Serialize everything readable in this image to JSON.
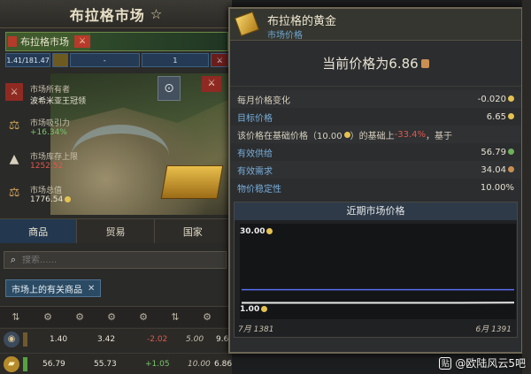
{
  "window": {
    "title": "布拉格市场",
    "star": "☆"
  },
  "market_bar": {
    "label": "布拉格市场",
    "flag": "⚔"
  },
  "stats": {
    "ratio": "1.41/181.47",
    "pop": "-",
    "count": "1",
    "extra": "⚔"
  },
  "owner": {
    "label": "市场所有者",
    "value": "波希米亚王冠领"
  },
  "attraction": {
    "label": "市场吸引力",
    "value": "+16.34%"
  },
  "storage": {
    "label": "市场库存上限",
    "value": "1252.52"
  },
  "total": {
    "label": "市场总值",
    "value": "1776.54"
  },
  "tabs": [
    {
      "label": "商品"
    },
    {
      "label": "贸易"
    },
    {
      "label": "国家"
    }
  ],
  "search": {
    "placeholder": "搜索......"
  },
  "filter": {
    "label": "市场上的有关商品",
    "close": "✕"
  },
  "rows": [
    {
      "icon": "grain",
      "c1": "1.40",
      "c2": "3.42",
      "c3": "-2.02",
      "c4": "5.00",
      "c5": "9.6"
    },
    {
      "icon": "gold",
      "c1": "56.79",
      "c2": "55.73",
      "c3": "+1.05",
      "c4": "10.00",
      "c5": "6.86"
    }
  ],
  "tooltip": {
    "name": "布拉格的黄金",
    "subtitle": "市场价格",
    "current_price": "当前价格为6.86",
    "monthly_change_label": "每月价格变化",
    "monthly_change_value": "-0.020",
    "target_label": "目标价格",
    "target_value": "6.65",
    "base_prefix": "该价格在基础价格（10.00",
    "base_mid": "）的基础上",
    "base_pct": "-33.4%",
    "base_suffix": "，基于",
    "supply_label": "有效供给",
    "supply_value": "56.79",
    "demand_label": "有效需求",
    "demand_value": "34.04",
    "stability_label": "物价稳定性",
    "stability_value": "10.00%",
    "chart_title": "近期市场价格"
  },
  "chart_data": {
    "type": "line",
    "title": "近期市场价格",
    "ylim": [
      1.0,
      30.0
    ],
    "y_top_label": "30.00",
    "y_bottom_label": "1.00",
    "x_start": "7月 1381",
    "x_end": "6月 1391",
    "series": [
      {
        "values": [
          6.86,
          6.86,
          6.86,
          6.86,
          6.86,
          6.86
        ]
      },
      {
        "values": [
          1.2,
          1.2,
          1.2,
          1.2,
          1.2,
          1.3
        ]
      }
    ]
  },
  "watermark": "@欧陆风云5吧",
  "colors": {
    "accent_blue": "#6fa7d4",
    "negative": "#e0584d",
    "positive": "#79c66a",
    "price_line": "#5a6ff0",
    "floor_line": "#e9e9e9"
  }
}
